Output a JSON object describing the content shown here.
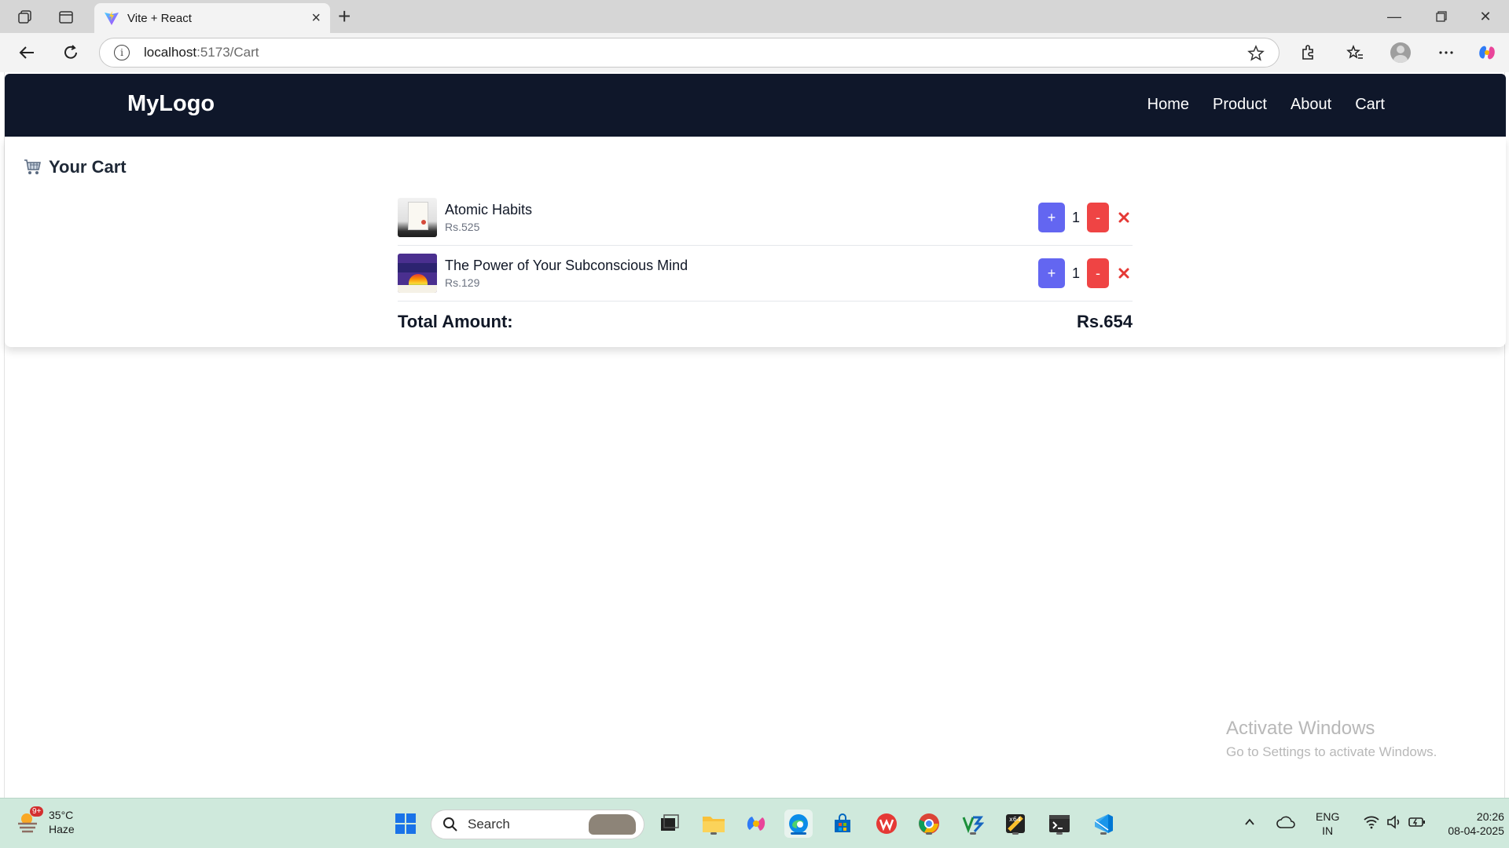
{
  "browser": {
    "tab_title": "Vite + React",
    "url_host": "localhost",
    "url_path": ":5173/Cart"
  },
  "navbar": {
    "logo": "MyLogo",
    "links": [
      "Home",
      "Product",
      "About",
      "Cart"
    ]
  },
  "cart": {
    "heading": "Your Cart",
    "items": [
      {
        "name": "Atomic Habits",
        "price": "Rs.525",
        "quantity": "1",
        "plus_label": "+",
        "minus_label": "-"
      },
      {
        "name": "The Power of Your Subconscious Mind",
        "price": "Rs.129",
        "quantity": "1",
        "plus_label": "+",
        "minus_label": "-"
      }
    ],
    "total_label": "Total Amount:",
    "total_value": "Rs.654"
  },
  "watermark": {
    "title": "Activate Windows",
    "subtitle": "Go to Settings to activate Windows."
  },
  "taskbar": {
    "weather_temp": "35°C",
    "weather_condition": "Haze",
    "weather_badge": "9+",
    "search_placeholder": "Search",
    "language_primary": "ENG",
    "language_secondary": "IN",
    "time": "20:26",
    "date": "08-04-2025"
  },
  "colors": {
    "navbar_bg": "#0f172a",
    "plus_button": "#6366f1",
    "minus_button": "#ef4444",
    "remove_icon": "#e53935",
    "taskbar_bg": "#cfe9dc"
  },
  "icons": {
    "tab_favicon": "vite-logo-icon",
    "cart_heading": "shopping-cart-icon",
    "remove": "close-x-icon"
  }
}
